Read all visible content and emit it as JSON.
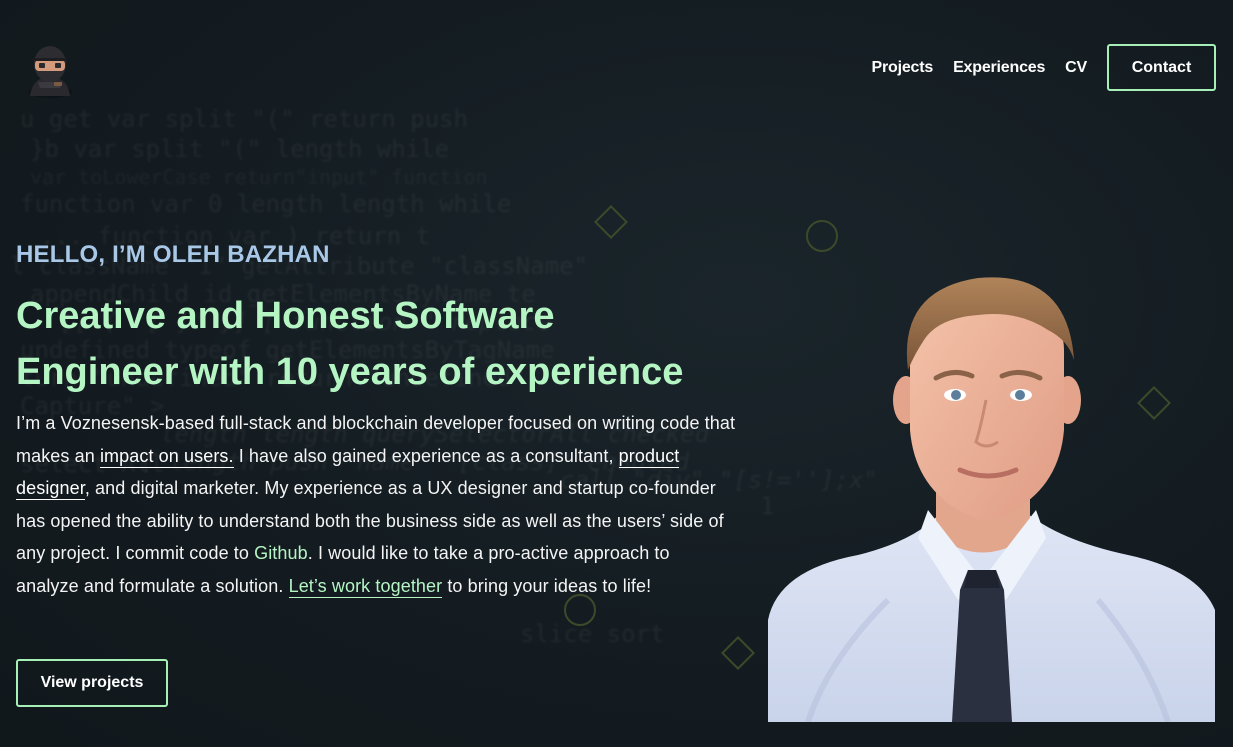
{
  "header": {
    "logo_alt": "ninja avatar",
    "nav": {
      "projects": "Projects",
      "experiences": "Experiences",
      "cv": "CV",
      "contact": "Contact"
    }
  },
  "hero": {
    "greeting": "HELLO, I’M OLEH BAZHAN",
    "headline_line1": "Creative and Honest Software",
    "headline_line2": "Engineer with 10 years of experience",
    "bio": {
      "p1": "I’m a Voznesensk-based full-stack and blockchain developer focused on writing code that makes an ",
      "link_impact": "impact on users.",
      "p2": " I have also gained experience as a consultant, ",
      "link_product": "product designer",
      "p3": ", and digital marketer. My experience as a UX designer and startup co-founder has opened the ability to understand both the business side as well as the users’ side of any project. I commit code to ",
      "link_github": "Github",
      "p4": ". I would like to take a pro-active approach to analyze and formulate a solution. ",
      "link_work": "Let’s work together",
      "p5": " to bring your ideas to life!"
    },
    "cta": "View projects"
  },
  "colors": {
    "background": "#131b20",
    "accent_green": "#b5f5c4",
    "greeting_blue": "#a9c8e8",
    "button_border": "#a6f0b7"
  }
}
